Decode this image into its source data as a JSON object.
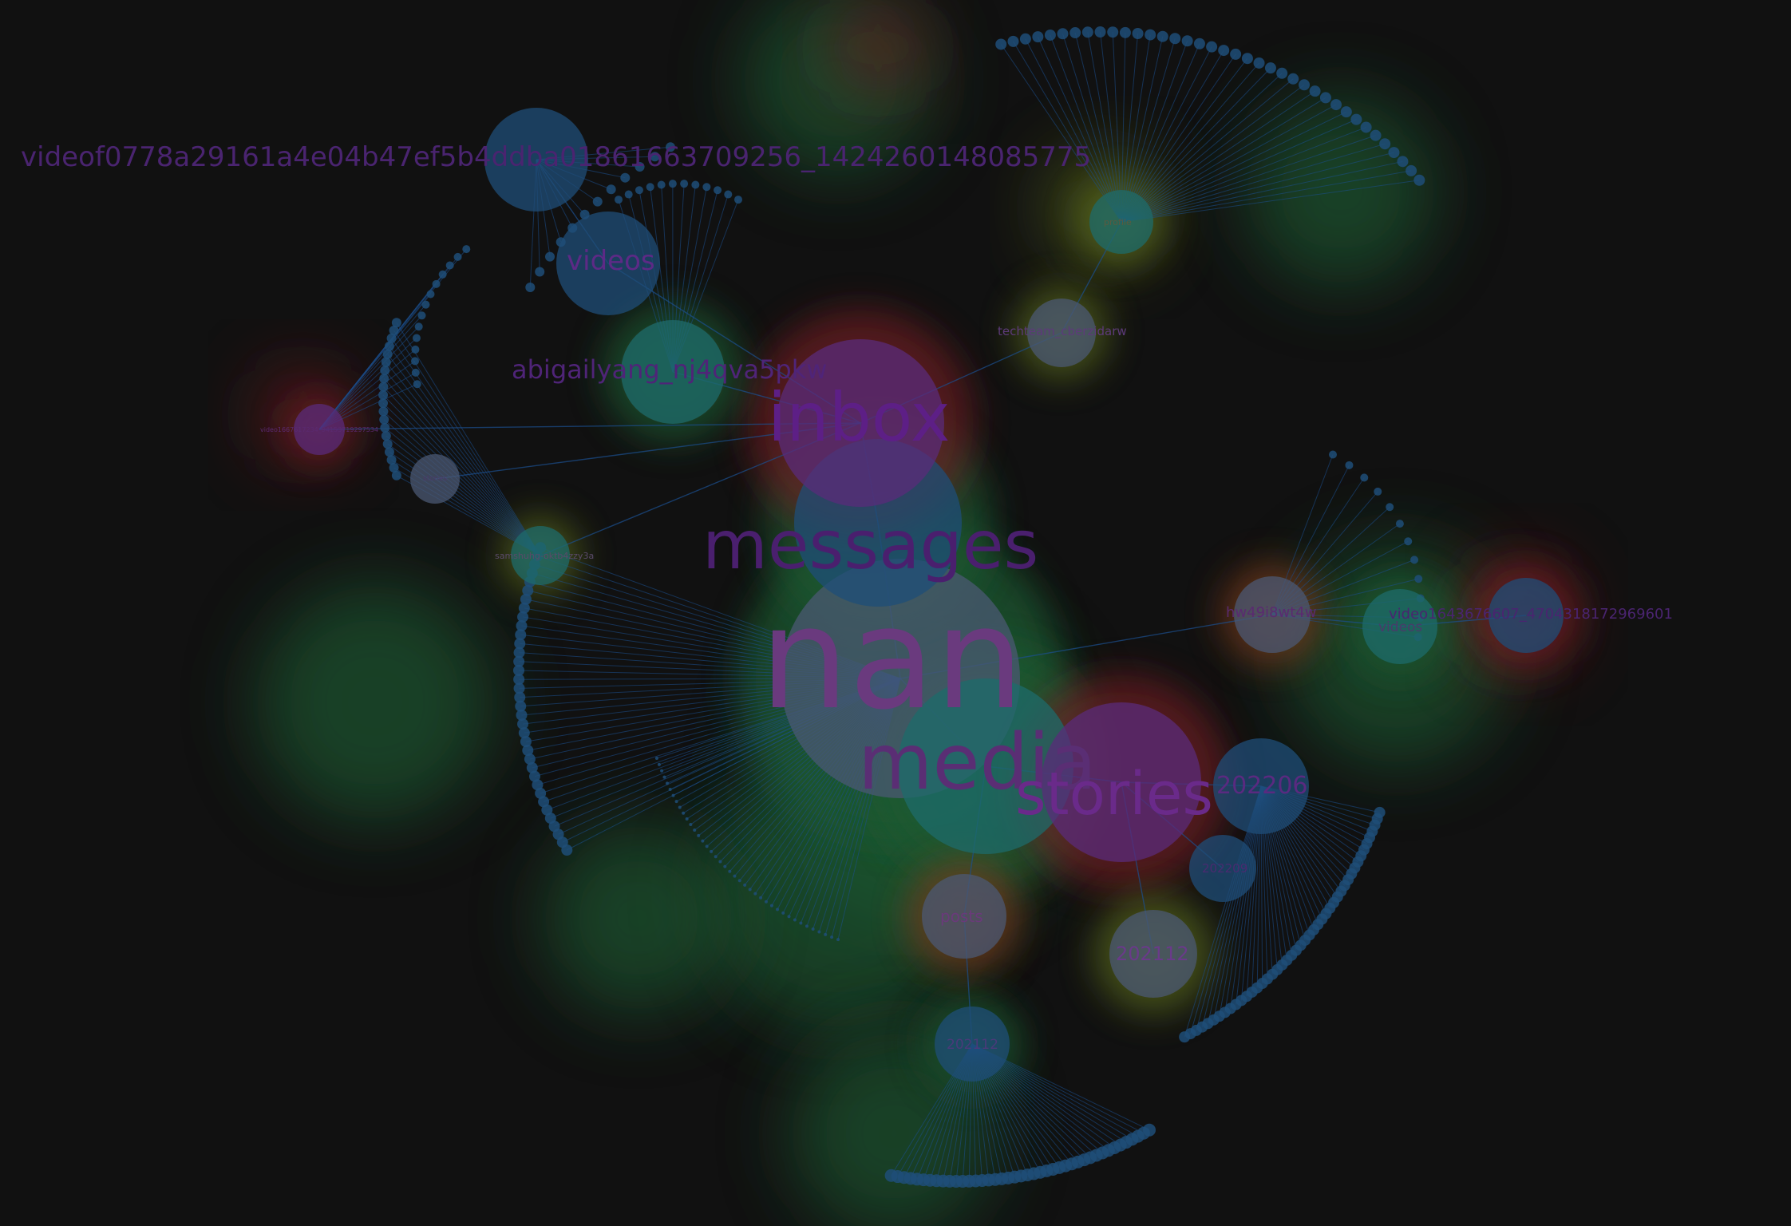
{
  "colors": {
    "background": "#111111",
    "edge": "#1b4f8f",
    "node_blue": "#1f4d78",
    "node_teal": "#1d6b6b",
    "node_purple": "#5a2b7a",
    "node_slate": "#4b5873",
    "label_purple": "#5d2a86",
    "label_mauve": "#7a4a8a",
    "glow_green": "#1f5a33",
    "glow_red": "#6e1f24",
    "glow_orange": "#7a3a1c",
    "glow_yellow": "#5a6a1c"
  },
  "labels": {
    "nan": "nan",
    "messages": "messages",
    "inbox": "inbox",
    "media": "media",
    "stories": "stories",
    "video_long": "videof0778a29161a4e04b47ef5b4ddba01861663709256_1424260148085775",
    "videos_top": "videos",
    "abigail": "abigailyang_nj4qva5pkw",
    "techteam": "techteam_cberzidarw",
    "profile": "profile",
    "samshu": "samshuhg-oktb4zzy3a",
    "hw49": "hw49i8wt4w",
    "videos_right": "videos",
    "video_right": "video1643676607_4704318172969601",
    "p202206": "202206",
    "p202209": "202209",
    "p202112a": "202112",
    "p202112b": "202112",
    "posts": "posts",
    "small_left": "video1667617234_94153719297534",
    "small_mid": "stories"
  },
  "hubs": [
    {
      "id": "nan",
      "label_key": "nan",
      "color": "node_slate",
      "glow": "glow_green"
    },
    {
      "id": "messages",
      "label_key": "messages",
      "color": "node_blue",
      "glow": "glow_green"
    },
    {
      "id": "inbox",
      "label_key": "inbox",
      "color": "node_purple",
      "glow": "glow_red"
    },
    {
      "id": "media",
      "label_key": "media",
      "color": "node_teal",
      "glow": "glow_green"
    },
    {
      "id": "stories",
      "label_key": "stories",
      "color": "node_purple",
      "glow": "glow_red"
    },
    {
      "id": "video_long_node",
      "label_key": "video_long",
      "color": "node_blue",
      "glow": ""
    },
    {
      "id": "videos_top",
      "label_key": "videos_top",
      "color": "node_blue",
      "glow": ""
    },
    {
      "id": "abigail",
      "label_key": "abigail",
      "color": "node_teal",
      "glow": "glow_green"
    },
    {
      "id": "techteam",
      "label_key": "techteam",
      "color": "node_slate",
      "glow": "glow_yellow"
    },
    {
      "id": "profile",
      "label_key": "profile",
      "color": "node_teal",
      "glow": "glow_yellow"
    },
    {
      "id": "samshu",
      "label_key": "samshu",
      "color": "node_teal",
      "glow": "glow_yellow"
    },
    {
      "id": "hw49",
      "label_key": "hw49",
      "color": "node_slate",
      "glow": "glow_orange"
    },
    {
      "id": "videos_right",
      "label_key": "videos_right",
      "color": "node_teal",
      "glow": "glow_green"
    },
    {
      "id": "video_right",
      "label_key": "video_right",
      "color": "node_blue",
      "glow": "glow_red"
    },
    {
      "id": "p202206",
      "label_key": "p202206",
      "color": "node_blue",
      "glow": ""
    },
    {
      "id": "p202209",
      "label_key": "p202209",
      "color": "node_blue",
      "glow": ""
    },
    {
      "id": "p202112a",
      "label_key": "p202112a",
      "color": "node_slate",
      "glow": "glow_yellow"
    },
    {
      "id": "p202112b",
      "label_key": "p202112b",
      "color": "node_blue",
      "glow": "glow_green"
    },
    {
      "id": "posts",
      "label_key": "posts",
      "color": "node_slate",
      "glow": "glow_orange"
    },
    {
      "id": "small_left",
      "label_key": "small_left",
      "color": "node_purple",
      "glow": "glow_red"
    },
    {
      "id": "small_mid",
      "label_key": "small_mid",
      "color": "node_slate",
      "glow": ""
    }
  ]
}
